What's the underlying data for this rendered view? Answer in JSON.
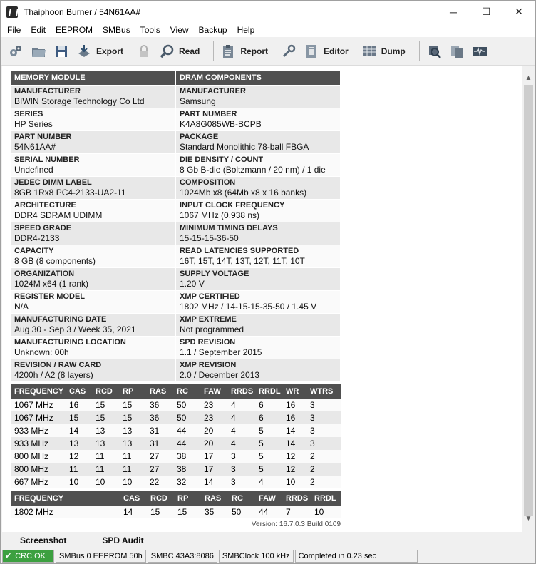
{
  "window": {
    "title": "Thaiphoon Burner / 54N61AA#",
    "minimize_glyph": "─",
    "maximize_glyph": "☐",
    "close_glyph": "✕"
  },
  "menu": [
    "File",
    "Edit",
    "EEPROM",
    "SMBus",
    "Tools",
    "View",
    "Backup",
    "Help"
  ],
  "toolbar": {
    "export_label": "Export",
    "read_label": "Read",
    "report_label": "Report",
    "editor_label": "Editor",
    "dump_label": "Dump"
  },
  "spd": {
    "module_header": "MEMORY MODULE",
    "dram_header": "DRAM COMPONENTS",
    "rows": [
      [
        {
          "k": "MANUFACTURER",
          "v": "BIWIN Storage Technology Co Ltd"
        },
        {
          "k": "MANUFACTURER",
          "v": "Samsung"
        }
      ],
      [
        {
          "k": "SERIES",
          "v": "HP Series"
        },
        {
          "k": "PART NUMBER",
          "v": "K4A8G085WB-BCPB"
        }
      ],
      [
        {
          "k": "PART NUMBER",
          "v": "54N61AA#"
        },
        {
          "k": "PACKAGE",
          "v": "Standard Monolithic 78-ball FBGA"
        }
      ],
      [
        {
          "k": "SERIAL NUMBER",
          "v": "Undefined"
        },
        {
          "k": "DIE DENSITY / COUNT",
          "v": "8 Gb B-die (Boltzmann / 20 nm) / 1 die"
        }
      ],
      [
        {
          "k": "JEDEC DIMM LABEL",
          "v": "8GB 1Rx8 PC4-2133-UA2-11"
        },
        {
          "k": "COMPOSITION",
          "v": "1024Mb x8 (64Mb x8 x 16 banks)"
        }
      ],
      [
        {
          "k": "ARCHITECTURE",
          "v": "DDR4 SDRAM UDIMM"
        },
        {
          "k": "INPUT CLOCK FREQUENCY",
          "v": "1067 MHz (0.938 ns)"
        }
      ],
      [
        {
          "k": "SPEED GRADE",
          "v": "DDR4-2133"
        },
        {
          "k": "MINIMUM TIMING DELAYS",
          "v": "15-15-15-36-50"
        }
      ],
      [
        {
          "k": "CAPACITY",
          "v": "8 GB (8 components)"
        },
        {
          "k": "READ LATENCIES SUPPORTED",
          "v": "16T, 15T, 14T, 13T, 12T, 11T, 10T"
        }
      ],
      [
        {
          "k": "ORGANIZATION",
          "v": "1024M x64 (1 rank)"
        },
        {
          "k": "SUPPLY VOLTAGE",
          "v": "1.20 V"
        }
      ],
      [
        {
          "k": "REGISTER MODEL",
          "v": "N/A"
        },
        {
          "k": "XMP CERTIFIED",
          "v": "1802 MHz / 14-15-15-35-50 / 1.45 V"
        }
      ],
      [
        {
          "k": "MANUFACTURING DATE",
          "v": "Aug 30 - Sep 3 / Week 35, 2021"
        },
        {
          "k": "XMP EXTREME",
          "v": "Not programmed"
        }
      ],
      [
        {
          "k": "MANUFACTURING LOCATION",
          "v": "Unknown: 00h"
        },
        {
          "k": "SPD REVISION",
          "v": "1.1 / September 2015"
        }
      ],
      [
        {
          "k": "REVISION / RAW CARD",
          "v": "4200h / A2 (8 layers)"
        },
        {
          "k": "XMP REVISION",
          "v": "2.0 / December 2013"
        }
      ]
    ]
  },
  "timings": {
    "columns": [
      "FREQUENCY",
      "CAS",
      "RCD",
      "RP",
      "RAS",
      "RC",
      "FAW",
      "RRDS",
      "RRDL",
      "WR",
      "WTRS"
    ],
    "rows": [
      [
        "1067 MHz",
        "16",
        "15",
        "15",
        "36",
        "50",
        "23",
        "4",
        "6",
        "16",
        "3"
      ],
      [
        "1067 MHz",
        "15",
        "15",
        "15",
        "36",
        "50",
        "23",
        "4",
        "6",
        "16",
        "3"
      ],
      [
        "933 MHz",
        "14",
        "13",
        "13",
        "31",
        "44",
        "20",
        "4",
        "5",
        "14",
        "3"
      ],
      [
        "933 MHz",
        "13",
        "13",
        "13",
        "31",
        "44",
        "20",
        "4",
        "5",
        "14",
        "3"
      ],
      [
        "800 MHz",
        "12",
        "11",
        "11",
        "27",
        "38",
        "17",
        "3",
        "5",
        "12",
        "2"
      ],
      [
        "800 MHz",
        "11",
        "11",
        "11",
        "27",
        "38",
        "17",
        "3",
        "5",
        "12",
        "2"
      ],
      [
        "667 MHz",
        "10",
        "10",
        "10",
        "22",
        "32",
        "14",
        "3",
        "4",
        "10",
        "2"
      ]
    ]
  },
  "xmp": {
    "columns": [
      "FREQUENCY",
      "CAS",
      "RCD",
      "RP",
      "RAS",
      "RC",
      "FAW",
      "RRDS",
      "RRDL"
    ],
    "rows": [
      [
        "1802 MHz",
        "14",
        "15",
        "15",
        "35",
        "50",
        "44",
        "7",
        "10"
      ]
    ]
  },
  "version": "Version: 16.7.0.3 Build 0109",
  "tabs": [
    "Screenshot",
    "SPD Audit"
  ],
  "status": {
    "crc": "CRC OK",
    "smbus": "SMBus 0 EEPROM 50h",
    "smbc": "SMBC 43A3:8086",
    "smbclock": "SMBClock 100 kHz",
    "completed": "Completed in 0.23 sec"
  },
  "colors": {
    "header_bg": "#505050",
    "row_shade": "#e8e8e8",
    "crc_ok": "#3ca040"
  }
}
